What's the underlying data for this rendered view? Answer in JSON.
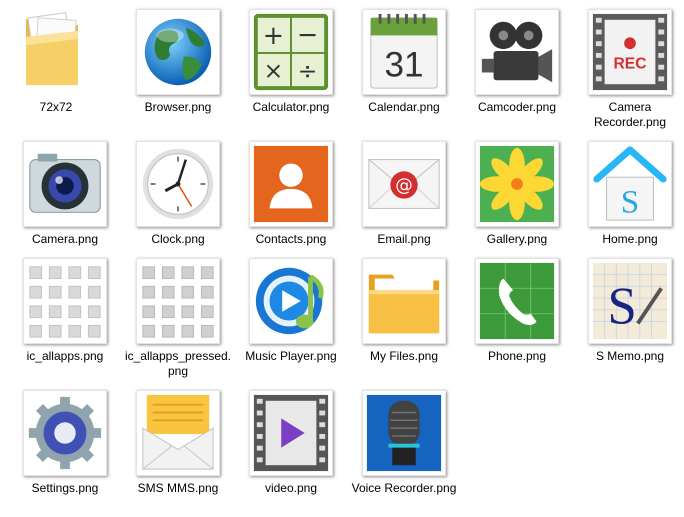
{
  "items": [
    {
      "label": "72x72",
      "icon": "folder-icon"
    },
    {
      "label": "Browser.png",
      "icon": "globe-icon"
    },
    {
      "label": "Calculator.png",
      "icon": "calculator-icon"
    },
    {
      "label": "Calendar.png",
      "icon": "calendar-icon",
      "calendar_day": "31"
    },
    {
      "label": "Camcoder.png",
      "icon": "camcorder-icon"
    },
    {
      "label": "Camera Recorder.png",
      "icon": "film-rec-icon",
      "rec_text": "REC"
    },
    {
      "label": "Camera.png",
      "icon": "camera-icon"
    },
    {
      "label": "Clock.png",
      "icon": "clock-icon"
    },
    {
      "label": "Contacts.png",
      "icon": "contact-icon"
    },
    {
      "label": "Email.png",
      "icon": "email-icon"
    },
    {
      "label": "Gallery.png",
      "icon": "flower-icon"
    },
    {
      "label": "Home.png",
      "icon": "home-icon",
      "home_letter": "S"
    },
    {
      "label": "ic_allapps.png",
      "icon": "app-grid-icon"
    },
    {
      "label": "ic_allapps_pressed.png",
      "icon": "app-grid-pressed-icon"
    },
    {
      "label": "Music Player.png",
      "icon": "music-player-icon"
    },
    {
      "label": "My Files.png",
      "icon": "my-files-folder-icon"
    },
    {
      "label": "Phone.png",
      "icon": "phone-icon"
    },
    {
      "label": "S Memo.png",
      "icon": "s-memo-icon",
      "memo_letter": "S"
    },
    {
      "label": "Settings.png",
      "icon": "settings-gear-icon"
    },
    {
      "label": "SMS MMS.png",
      "icon": "envelope-letter-icon"
    },
    {
      "label": "video.png",
      "icon": "video-play-icon"
    },
    {
      "label": "Voice Recorder.png",
      "icon": "microphone-icon"
    }
  ]
}
